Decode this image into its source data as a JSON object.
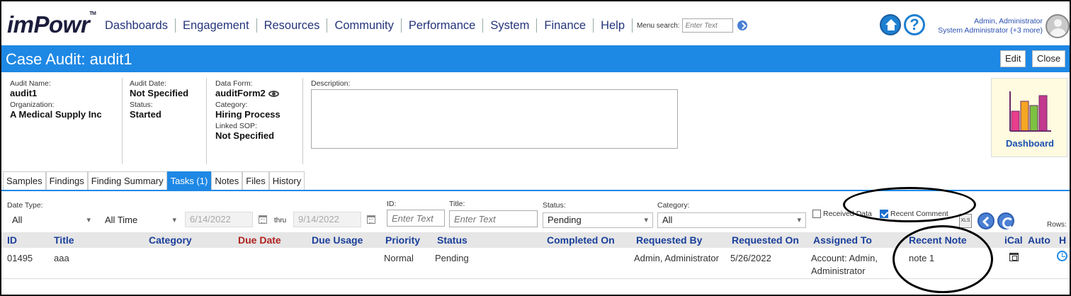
{
  "app": {
    "logo": "imPowr",
    "logo_tm": "TM"
  },
  "nav": {
    "items": [
      "Dashboards",
      "Engagement",
      "Resources",
      "Community",
      "Performance",
      "System",
      "Finance",
      "Help"
    ],
    "menu_search_label": "Menu search:",
    "menu_search_placeholder": "Enter Text"
  },
  "user": {
    "name": "Admin, Administrator",
    "role": "System Administrator (+3 more)"
  },
  "page": {
    "title": "Case Audit: audit1",
    "edit_label": "Edit",
    "close_label": "Close"
  },
  "audit": {
    "audit_name_label": "Audit Name:",
    "audit_name": "audit1",
    "organization_label": "Organization:",
    "organization": "A Medical Supply Inc",
    "audit_date_label": "Audit Date:",
    "audit_date": "Not Specified",
    "status_label": "Status:",
    "status": "Started",
    "data_form_label": "Data Form:",
    "data_form": "auditForm2",
    "category_label": "Category:",
    "category": "Hiring Process",
    "linked_sop_label": "Linked SOP:",
    "linked_sop": "Not Specified",
    "description_label": "Description:",
    "description": ""
  },
  "dashboard_card": {
    "label": "Dashboard",
    "bar_colors": [
      "#e83e8c",
      "#f5a623",
      "#7cc242",
      "#c23a8c"
    ]
  },
  "tabs": [
    {
      "label": "Samples",
      "active": false
    },
    {
      "label": "Findings",
      "active": false
    },
    {
      "label": "Finding Summary",
      "active": false
    },
    {
      "label": "Tasks (1)",
      "active": true
    },
    {
      "label": "Notes",
      "active": false
    },
    {
      "label": "Files",
      "active": false
    },
    {
      "label": "History",
      "active": false
    }
  ],
  "filters": {
    "date_type_label": "Date Type:",
    "date_type_value": "All",
    "range_value": "All Time",
    "date_from": "6/14/2022",
    "thru_label": "thru",
    "date_to": "9/14/2022",
    "id_label": "ID:",
    "id_placeholder": "Enter Text",
    "title_label": "Title:",
    "title_placeholder": "Enter Text",
    "status_label": "Status:",
    "status_value": "Pending",
    "category_label": "Category:",
    "category_value": "All",
    "received_data_label": "Received Data",
    "received_data_checked": false,
    "recent_comment_label": "Recent Comment",
    "recent_comment_checked": true,
    "xls_label": "XLS",
    "rows_label": "Rows:"
  },
  "table": {
    "columns": [
      "ID",
      "Title",
      "Category",
      "Due Date",
      "Due Usage",
      "Priority",
      "Status",
      "Completed On",
      "Requested By",
      "Requested On",
      "Assigned To",
      "Recent Note",
      "iCal",
      "Auto",
      "H"
    ],
    "rows": [
      {
        "id": "01495",
        "title": "aaa",
        "category": "",
        "due_date": "",
        "due_usage": "",
        "priority": "Normal",
        "status": "Pending",
        "completed_on": "",
        "requested_by": "Admin, Administrator",
        "requested_on": "5/26/2022",
        "assigned_to": "Account: Admin, Administrator",
        "recent_note": "note 1"
      }
    ]
  },
  "colors": {
    "accent": "#1e88e5",
    "nav_text": "#24347a",
    "header_text": "#1a3f9a",
    "due_date_header": "#b02020"
  }
}
